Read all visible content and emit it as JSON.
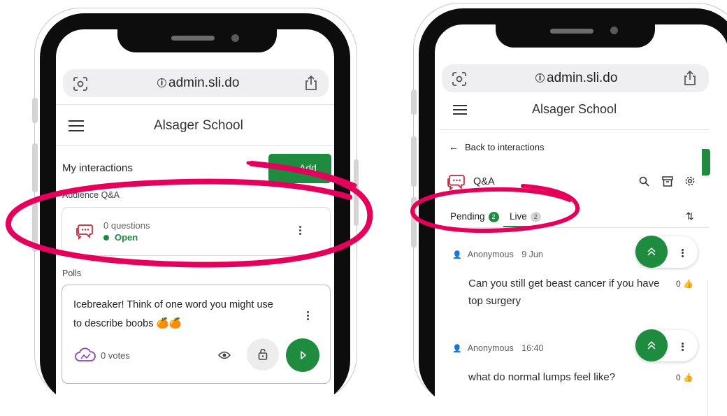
{
  "colors": {
    "accent": "#1e8b3e",
    "annotation": "#e5005c",
    "qa_icon": "#c0263a"
  },
  "left_phone": {
    "browser": {
      "url": "admin.sli.do"
    },
    "header": {
      "title": "Alsager School"
    },
    "main": {
      "section_title": "My interactions",
      "add_label": "Add",
      "qa_label": "Audience Q&A",
      "qa_card": {
        "questions": "0 questions",
        "status": "Open"
      },
      "polls_label": "Polls",
      "poll_card": {
        "line1": "Icebreaker! Think of one word you might use",
        "line2": "to describe boobs 🍊🍊",
        "votes": "0 votes"
      }
    }
  },
  "right_phone": {
    "browser": {
      "url": "admin.sli.do"
    },
    "header": {
      "title": "Alsager School"
    },
    "back_label": "Back to interactions",
    "qa_title": "Q&A",
    "tabs": [
      {
        "label": "Pending",
        "count": "2"
      },
      {
        "label": "Live",
        "count": "2"
      }
    ],
    "questions": [
      {
        "author": "Anonymous",
        "time": "9 Jun",
        "line1": "Can you still get beast cancer if you have",
        "line2": "top surgery",
        "likes": "0"
      },
      {
        "author": "Anonymous",
        "time": "16:40",
        "line1": "what do normal lumps feel like?",
        "likes": "0"
      }
    ]
  }
}
